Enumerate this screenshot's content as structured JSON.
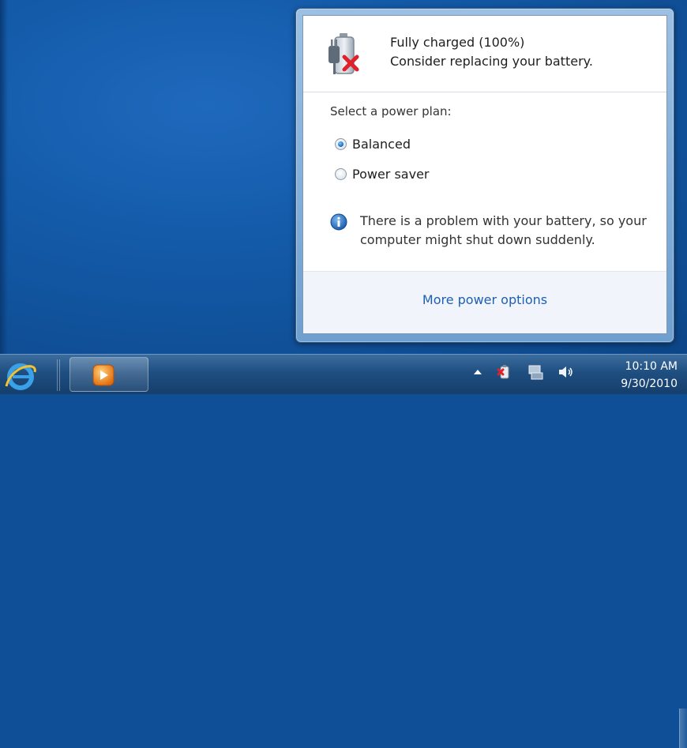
{
  "status": {
    "line1": "Fully charged (100%)",
    "line2": "Consider replacing your battery."
  },
  "plans": {
    "label": "Select a power plan:",
    "options": [
      {
        "label": "Balanced",
        "selected": true
      },
      {
        "label": "Power saver",
        "selected": false
      }
    ]
  },
  "warning": {
    "text": "There is a problem with your battery, so your computer might shut down suddenly."
  },
  "footer": {
    "link": "More power options"
  },
  "clock": {
    "time": "10:10 AM",
    "date": "9/30/2010"
  },
  "icons": {
    "battery": "battery-warning-icon",
    "info": "info-icon",
    "ie": "internet-explorer-icon",
    "media": "media-player-icon",
    "tray_arrow": "show-hidden-icons-arrow",
    "tray_power": "power-icon",
    "tray_network": "network-icon",
    "tray_volume": "volume-icon"
  },
  "colors": {
    "link": "#1d5fb3",
    "taskbar": "#1f4e80",
    "warning_x": "#e0202a"
  }
}
